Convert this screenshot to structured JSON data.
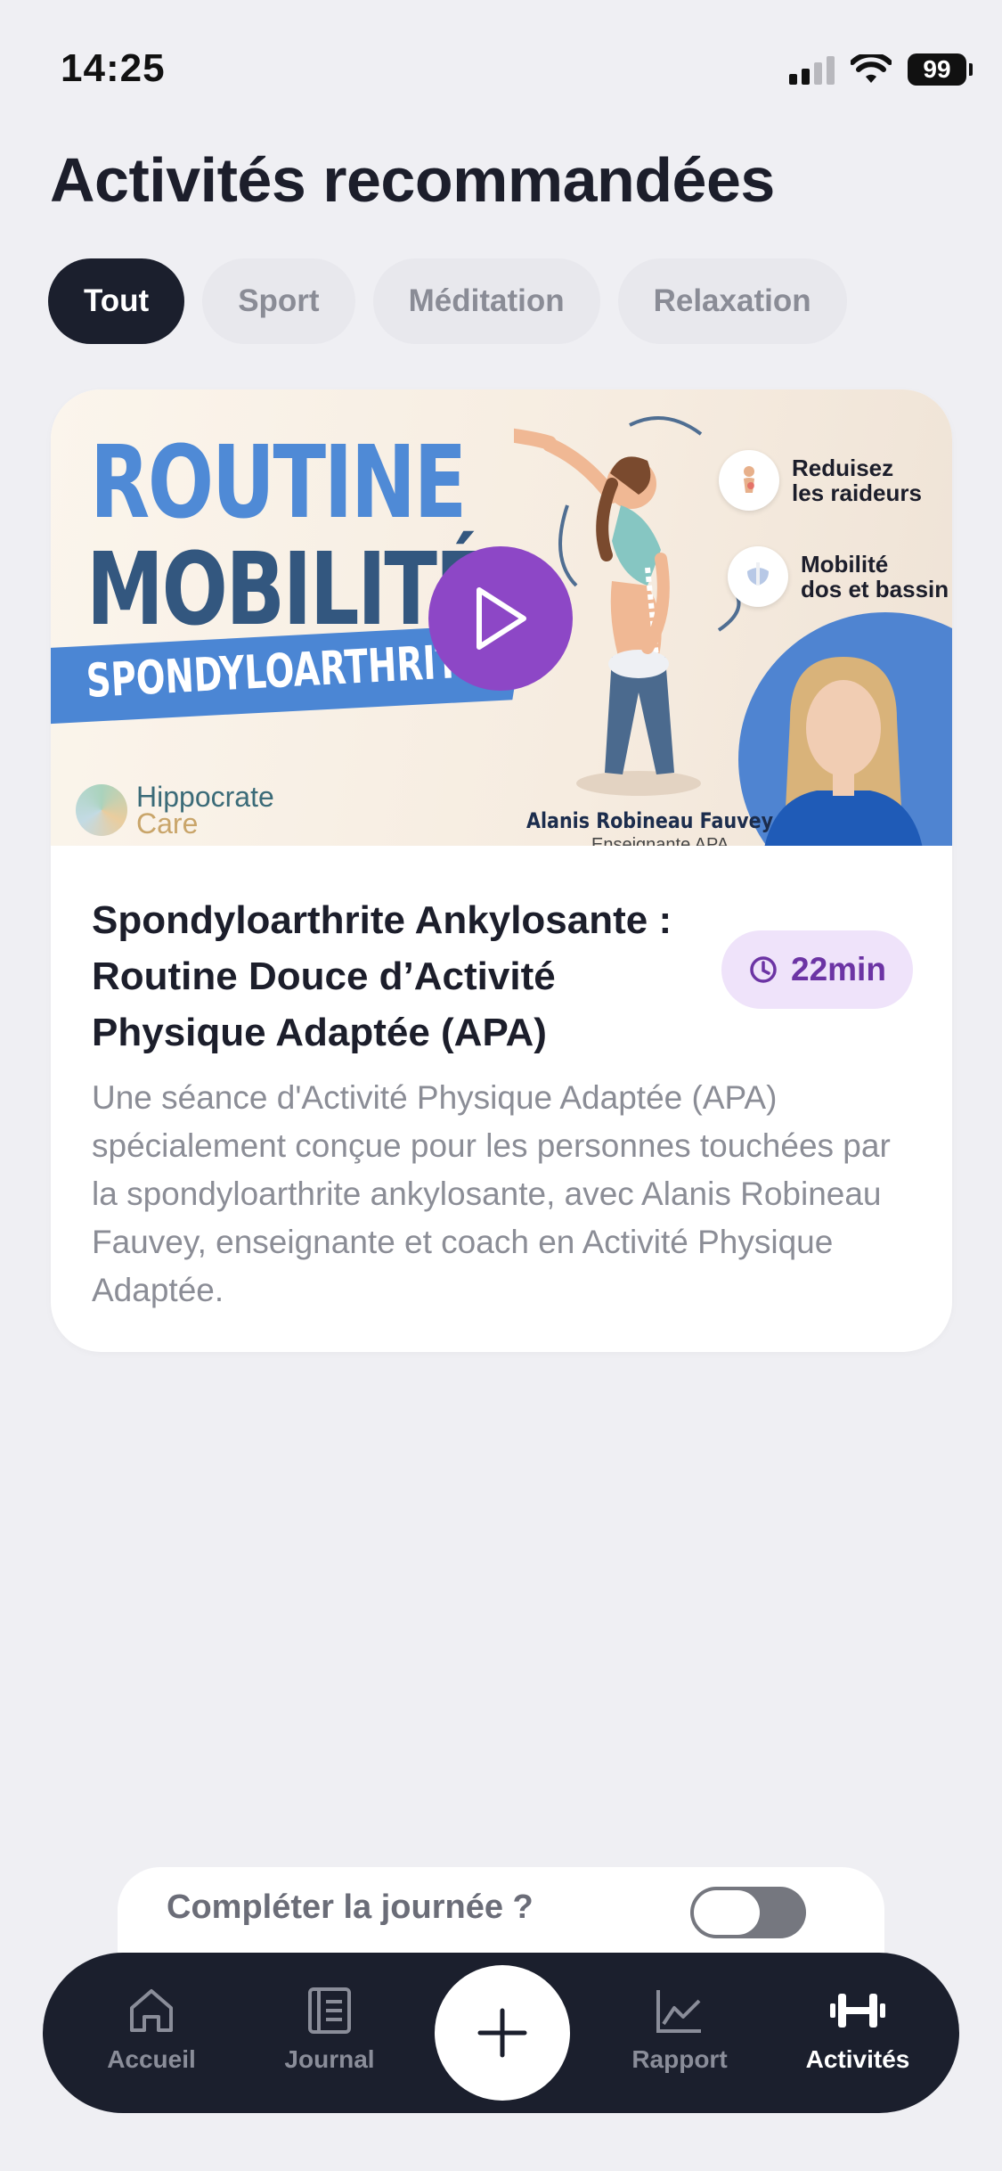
{
  "status": {
    "time": "14:25",
    "battery": "99"
  },
  "page": {
    "title": "Activités recommandées"
  },
  "filters": [
    {
      "label": "Tout",
      "active": true
    },
    {
      "label": "Sport",
      "active": false
    },
    {
      "label": "Méditation",
      "active": false
    },
    {
      "label": "Relaxation",
      "active": false
    }
  ],
  "card": {
    "thumbnail": {
      "title_line1": "ROUTINE",
      "title_line2": "MOBILITÉ",
      "ribbon": "SPONDYLOARTHRITE",
      "logo_line1": "Hippocrate",
      "logo_line2": "Care",
      "feature1_line1": "Reduisez",
      "feature1_line2": "les raideurs",
      "feature2_line1": "Mobilité",
      "feature2_line2": "dos et bassin",
      "coach_name": "Alanis Robineau Fauvey",
      "coach_role": "Enseignante APA",
      "accent_color": "#4f8ad6",
      "play_color": "#8d47c6"
    },
    "title": "Spondyloarthrite Ankylosante : Routine Douce d’Activité Physique Adaptée (APA)",
    "duration": "22min",
    "description": "Une séance d'Activité Physique Adaptée (APA) spécialement conçue pour les personnes touchées par la spondyloarthrite ankylosante, avec Alanis Robineau Fauvey, enseignante et coach en Activité Physique Adaptée."
  },
  "complete_day": {
    "label": "Compléter la journée ?",
    "toggle_on": false
  },
  "tabbar": {
    "items": [
      {
        "label": "Accueil",
        "icon": "home-icon"
      },
      {
        "label": "Journal",
        "icon": "journal-icon"
      },
      {
        "label": "Rapport",
        "icon": "chart-icon"
      },
      {
        "label": "Activités",
        "icon": "dumbbell-icon",
        "active": true
      }
    ]
  }
}
